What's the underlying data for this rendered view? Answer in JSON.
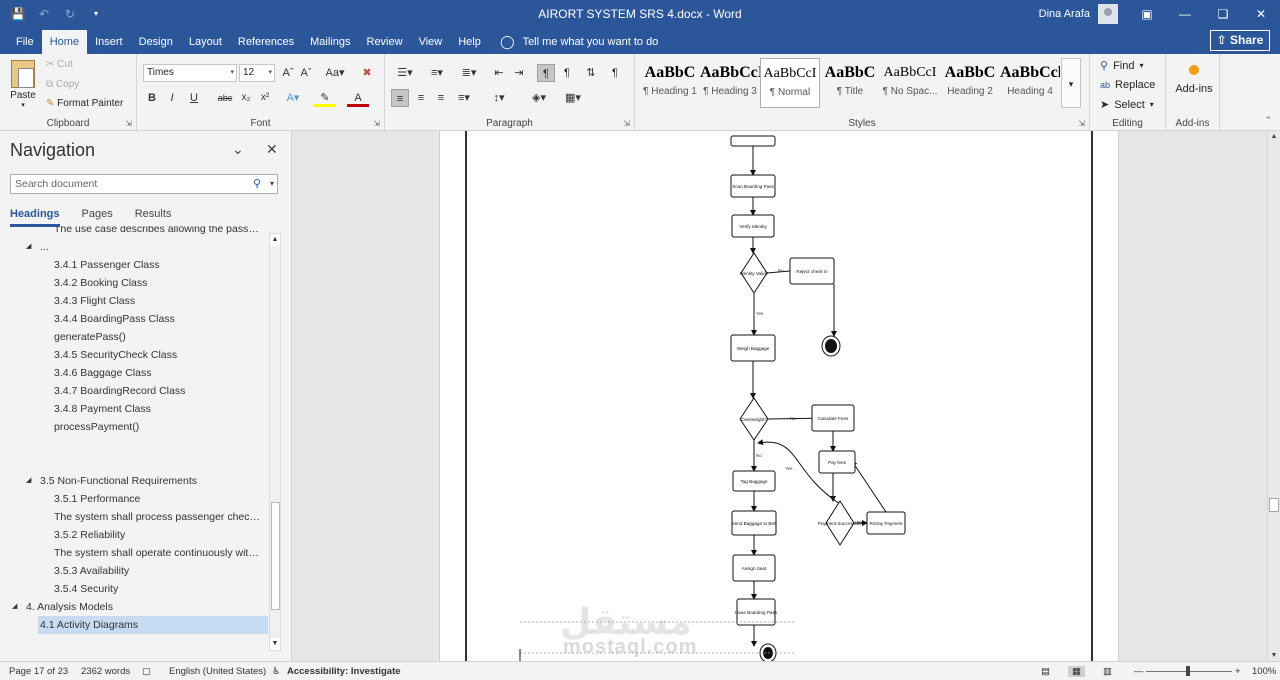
{
  "titlebar": {
    "title": "AIRORT SYSTEM SRS 4.docx  -  Word",
    "user": "Dina Arafa",
    "icons": [
      "save-icon",
      "undo-icon",
      "redo-icon",
      "customize-qat-icon"
    ],
    "window_buttons": [
      "ribbon-display-icon",
      "minimize-icon",
      "restore-icon",
      "close-icon"
    ]
  },
  "ribbon_tabs": {
    "items": [
      "File",
      "Home",
      "Insert",
      "Design",
      "Layout",
      "References",
      "Mailings",
      "Review",
      "View",
      "Help"
    ],
    "active": "Home",
    "tell_me": "Tell me what you want to do",
    "share": "Share"
  },
  "clipboard": {
    "paste": "Paste",
    "cut": "Cut",
    "copy": "Copy",
    "format_painter": "Format Painter",
    "label": "Clipboard"
  },
  "font": {
    "family": "Times",
    "size": "12",
    "label": "Font"
  },
  "paragraph": {
    "label": "Paragraph"
  },
  "styles": {
    "label": "Styles",
    "items": [
      {
        "sample": "AaBbC",
        "name": "¶ Heading 1",
        "big": true
      },
      {
        "sample": "AaBbCcI",
        "name": "¶ Heading 3",
        "big": true
      },
      {
        "sample": "AaBbCcI",
        "name": "¶ Normal",
        "big": false,
        "selected": true
      },
      {
        "sample": "AaBbC",
        "name": "¶ Title",
        "big": true
      },
      {
        "sample": "AaBbCcI",
        "name": "¶ No Spac...",
        "big": false
      },
      {
        "sample": "AaBbC",
        "name": "Heading 2",
        "big": true
      },
      {
        "sample": "AaBbCcl",
        "name": "Heading 4",
        "big": true
      }
    ]
  },
  "editing": {
    "find": "Find",
    "replace": "Replace",
    "select": "Select",
    "label": "Editing"
  },
  "addins": {
    "button": "Add-ins",
    "label": "Add-ins"
  },
  "navigation": {
    "title": "Navigation",
    "search_placeholder": "Search document",
    "tabs": [
      "Headings",
      "Pages",
      "Results"
    ],
    "active_tab": "Headings",
    "items": [
      {
        "text": "The use case describes allowing the passenger...",
        "level": 2,
        "arrow": ""
      },
      {
        "text": "...",
        "level": 1,
        "arrow": "collapse"
      },
      {
        "text": "3.4.1 Passenger Class",
        "level": 2,
        "arrow": ""
      },
      {
        "text": "3.4.2 Booking Class",
        "level": 2,
        "arrow": ""
      },
      {
        "text": "3.4.3 Flight Class",
        "level": 2,
        "arrow": ""
      },
      {
        "text": "3.4.4 BoardingPass Class",
        "level": 2,
        "arrow": ""
      },
      {
        "text": "generatePass()",
        "level": 2,
        "arrow": ""
      },
      {
        "text": "3.4.5 SecurityCheck Class",
        "level": 2,
        "arrow": ""
      },
      {
        "text": "3.4.6 Baggage Class",
        "level": 2,
        "arrow": ""
      },
      {
        "text": "3.4.7 BoardingRecord Class",
        "level": 2,
        "arrow": ""
      },
      {
        "text": "3.4.8 Payment Class",
        "level": 2,
        "arrow": ""
      },
      {
        "text": "processPayment()",
        "level": 2,
        "arrow": ""
      },
      {
        "text": "",
        "level": 2,
        "arrow": ""
      },
      {
        "text": "",
        "level": 2,
        "arrow": ""
      },
      {
        "text": "3.5 Non-Functional Requirements",
        "level": 1,
        "arrow": "collapse"
      },
      {
        "text": "3.5.1 Performance",
        "level": 2,
        "arrow": ""
      },
      {
        "text": "The system shall process passenger check-in, s...",
        "level": 2,
        "arrow": ""
      },
      {
        "text": "3.5.2 Reliability",
        "level": 2,
        "arrow": ""
      },
      {
        "text": "The system shall operate continuously with mi...",
        "level": 2,
        "arrow": ""
      },
      {
        "text": "3.5.3 Availability",
        "level": 2,
        "arrow": ""
      },
      {
        "text": "3.5.4 Security",
        "level": 2,
        "arrow": ""
      },
      {
        "text": "4. Analysis Models",
        "level": 0,
        "arrow": "collapse"
      },
      {
        "text": "4.1 Activity Diagrams",
        "level": 1,
        "arrow": "",
        "selected": true
      }
    ]
  },
  "diagram": {
    "nodes": [
      {
        "id": "top",
        "text": "",
        "shape": "rect"
      },
      {
        "id": "scan",
        "text": "Scan Boarding Pass",
        "shape": "rect"
      },
      {
        "id": "verify",
        "text": "Verify Identity",
        "shape": "rect"
      },
      {
        "id": "valid",
        "text": "Identity Valid?",
        "shape": "diamond"
      },
      {
        "id": "reject",
        "text": "Reject check in",
        "shape": "rect"
      },
      {
        "id": "end1",
        "text": "",
        "shape": "end"
      },
      {
        "id": "weigh",
        "text": "Weigh Baggage",
        "shape": "rect"
      },
      {
        "id": "overweight",
        "text": "Overweight?",
        "shape": "diamond"
      },
      {
        "id": "calc",
        "text": "Calculate Fees",
        "shape": "rect"
      },
      {
        "id": "pay",
        "text": "Pay fees",
        "shape": "rect"
      },
      {
        "id": "paysuccess",
        "text": "Payment Successful?",
        "shape": "diamond"
      },
      {
        "id": "retry",
        "text": "Retray Payment",
        "shape": "rect"
      },
      {
        "id": "tag",
        "text": "Tag Baggage",
        "shape": "rect"
      },
      {
        "id": "send",
        "text": "Send Baggage to Belt",
        "shape": "rect"
      },
      {
        "id": "seat",
        "text": "Assign Seat",
        "shape": "rect"
      },
      {
        "id": "issue",
        "text": "Issue Boarding Pass",
        "shape": "rect"
      },
      {
        "id": "end2",
        "text": "",
        "shape": "end"
      }
    ],
    "edge_labels": {
      "no": "No",
      "yes": "Yes"
    }
  },
  "watermark": {
    "arabic": "مستقل",
    "latin": "mostaql.com"
  },
  "statusbar": {
    "page": "Page 17 of 23",
    "words": "2362 words",
    "language": "English (United States)",
    "accessibility": "Accessibility: Investigate",
    "zoom": "100%"
  }
}
